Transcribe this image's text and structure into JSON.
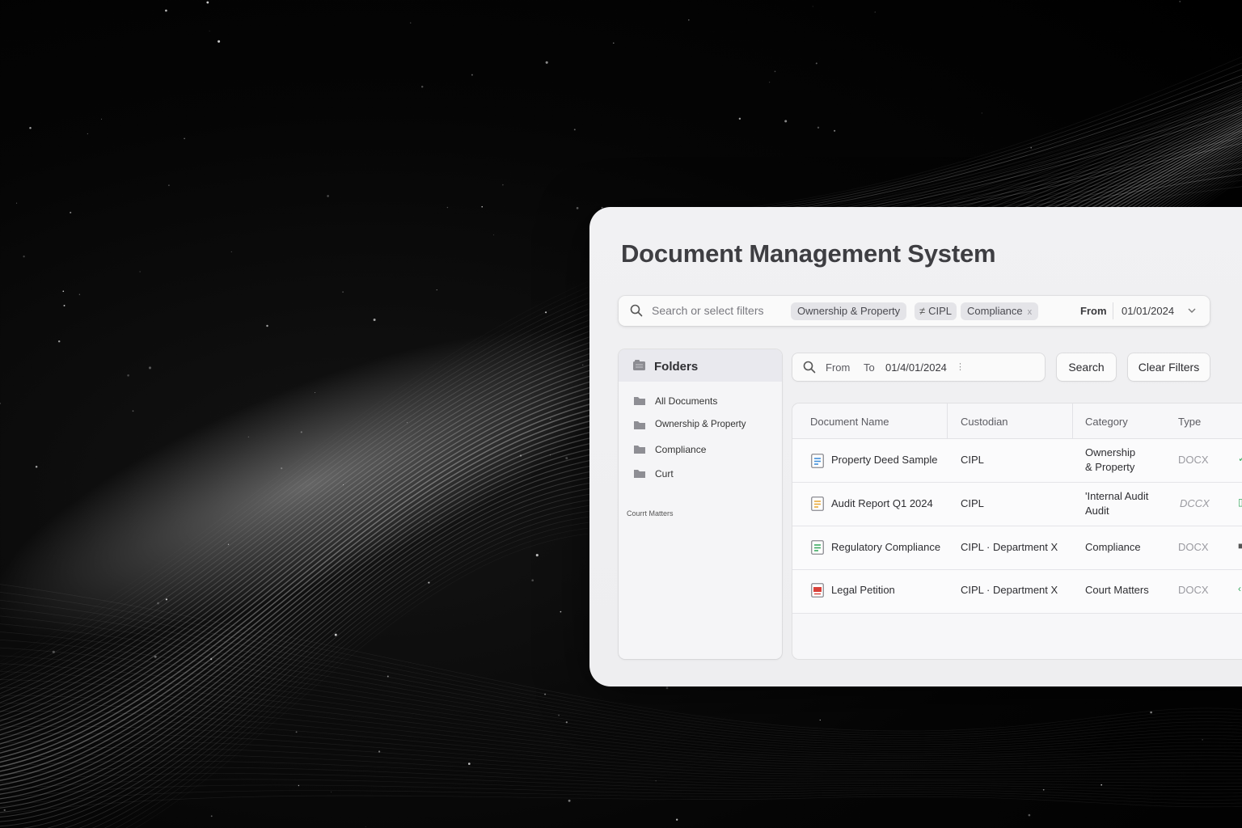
{
  "app": {
    "title": "Document Management System"
  },
  "filter_bar": {
    "search_placeholder": "Search or select filters",
    "chips": [
      {
        "label": "Ownership & Property"
      },
      {
        "prefix": "≠",
        "label": "CIPL"
      },
      {
        "label": "Compliance",
        "close": "x"
      }
    ],
    "from_label": "From",
    "from_date": "01/01/2024"
  },
  "sidebar": {
    "header": "Folders",
    "items": [
      {
        "label": "All Documents"
      },
      {
        "label": "Ownership & Property"
      },
      {
        "label": "Compliance"
      },
      {
        "label": "Curt"
      }
    ],
    "sub_label": "Courrt Matters"
  },
  "search_row": {
    "from_label": "From",
    "to_label": "To",
    "date_value": "01/4/01/2024",
    "search_button": "Search",
    "clear_button": "Clear Filters"
  },
  "table": {
    "columns": [
      "Document Name",
      "Custodian",
      "Category",
      "Type"
    ],
    "rows": [
      {
        "name": "Property Deed Sample",
        "custodian": "CIPL",
        "category_line1": "Ownership",
        "category_line2": "& Property",
        "type": "DOCX",
        "icon_color": "#3f8ed8"
      },
      {
        "name": "Audit Report Q1 2024",
        "custodian": "CIPL",
        "category_line1": "'Internal Audit",
        "category_line2": "Audit",
        "type": "DCCX",
        "icon_color": "#e8a93a"
      },
      {
        "name": "Regulatory Compliance",
        "custodian": "CIPL · Department X",
        "category_line1": "Compliance",
        "category_line2": "",
        "type": "DOCX",
        "icon_color": "#3aa860"
      },
      {
        "name": "Legal Petition",
        "custodian": "CIPL · Department X",
        "category_line1": "Court Matters",
        "category_line2": "",
        "type": "DOCX",
        "icon_color": "#d8413a"
      }
    ]
  },
  "colors": {
    "panel_bg": "#f0f0f2",
    "accent_green": "#3aa860",
    "accent_red": "#d8413a"
  }
}
